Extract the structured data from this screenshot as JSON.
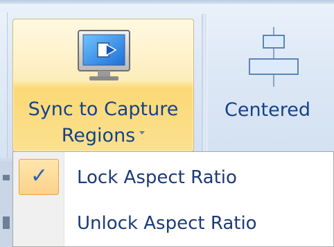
{
  "ribbon": {
    "sync_button": {
      "line1": "Sync to Capture",
      "line2": "Regions",
      "icon": "monitor-sync-icon"
    },
    "centered_button": {
      "label": "Centered",
      "icon": "align-center-icon"
    }
  },
  "menu": {
    "items": [
      {
        "label": "Lock Aspect Ratio",
        "checked": true
      },
      {
        "label": "Unlock Aspect Ratio",
        "checked": false
      }
    ]
  },
  "colors": {
    "accent_text": "#15428b",
    "hover_orange": "#fbd977",
    "check_blue": "#2b61b8"
  }
}
